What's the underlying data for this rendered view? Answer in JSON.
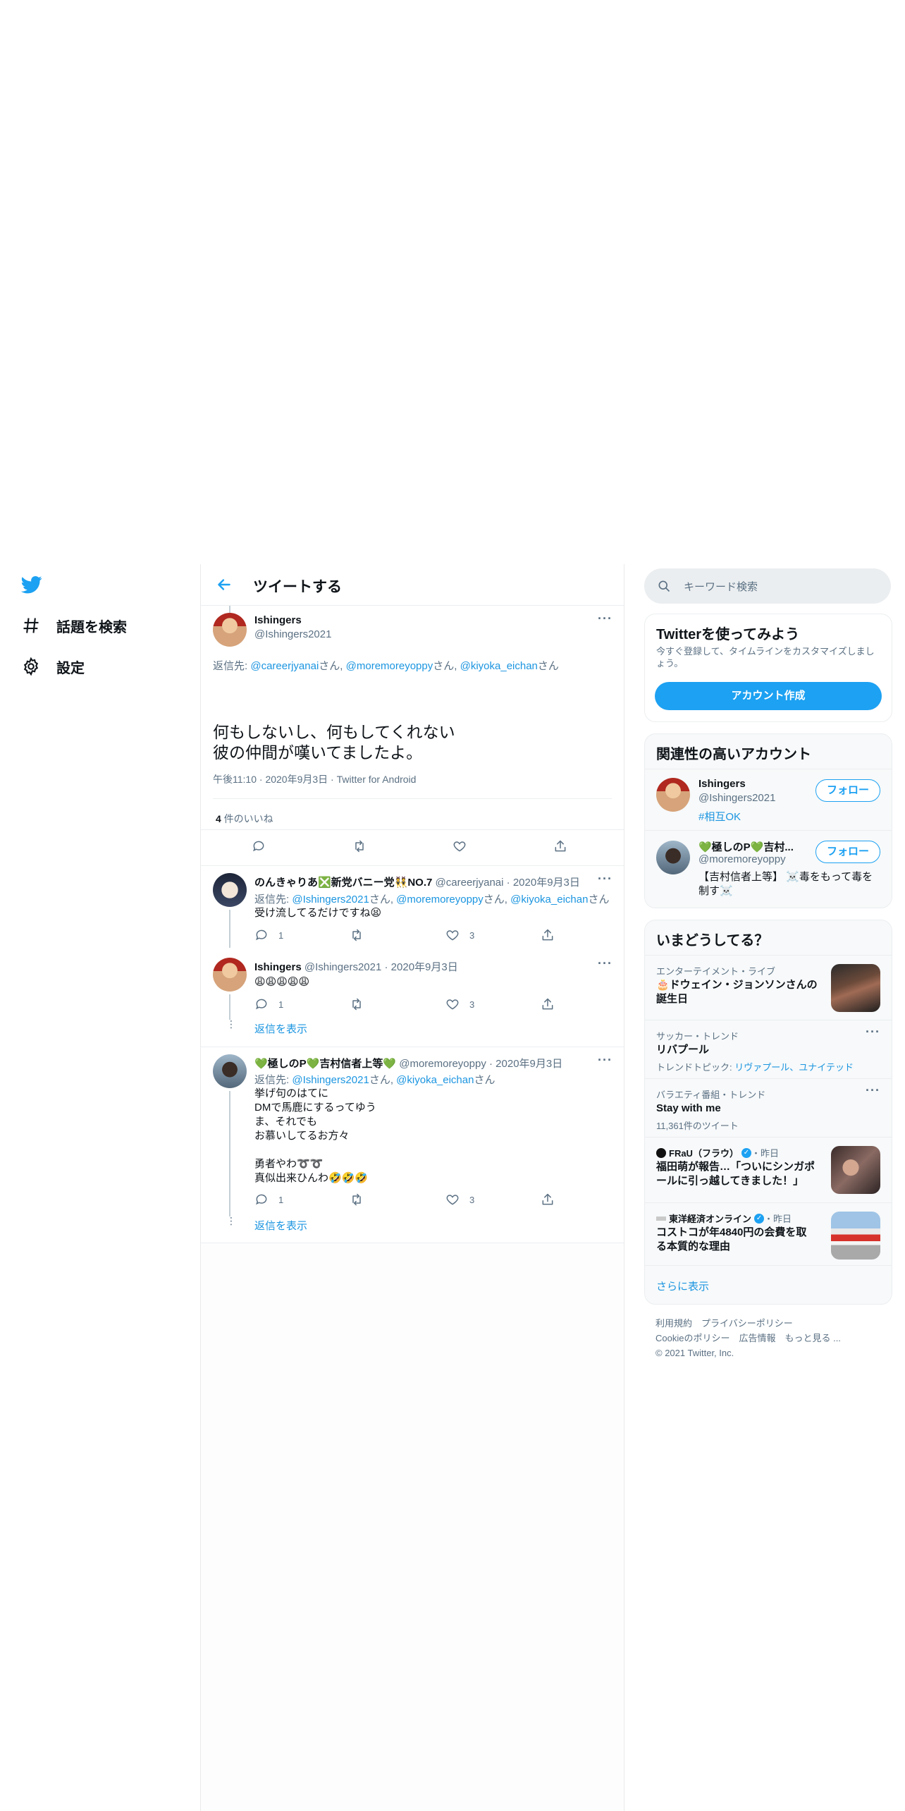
{
  "nav": {
    "items": [
      {
        "label": "話題を検索",
        "icon": "hashtag-icon"
      },
      {
        "label": "設定",
        "icon": "gear-icon"
      }
    ]
  },
  "header": {
    "title": "ツイートする"
  },
  "main_tweet": {
    "name": "Ishingers",
    "handle": "@Ishingers2021",
    "reply_prefix": "返信先: ",
    "reply_to": [
      "@careerjyanai",
      "@moremoreyoppy",
      "@kiyoka_eichan"
    ],
    "reply_suffix": "さん",
    "text_line1": "何もしないし、何もしてくれない",
    "text_line2": "彼の仲間が嘆いてましたよ。",
    "time": "午後11:10",
    "date": "2020年9月3日",
    "source": "Twitter for Android",
    "likes_count": "4",
    "likes_label": " 件のいいね"
  },
  "replies": [
    {
      "name": "のんきゃりあ❎新党バニー党👯NO.7",
      "handle": "@careerjyanai",
      "date": "2020年9月3日",
      "reply_to": [
        "@Ishingers2021",
        "@moremoreyoppy",
        "@kiyoka_eichan"
      ],
      "text": "受け流してるだけですね😫",
      "replies": "1",
      "likes": "3"
    },
    {
      "name": "Ishingers",
      "handle": "@Ishingers2021",
      "date": "2020年9月3日",
      "text": "😩😩😩😩😩",
      "replies": "1",
      "likes": "3",
      "show_more": "返信を表示"
    },
    {
      "name": "💚極しのP💚吉村信者上等💚",
      "handle": "@moremoreyoppy",
      "date": "2020年9月3日",
      "reply_to": [
        "@Ishingers2021",
        "@kiyoka_eichan"
      ],
      "lines": [
        "挙げ句のはてに",
        "DMで馬鹿にするってゆう",
        "ま、それでも",
        "お慕いしてるお方々",
        "",
        "勇者やわ➰➰",
        "真似出来ひんわ🤣🤣🤣"
      ],
      "replies": "1",
      "likes": "3",
      "show_more": "返信を表示"
    }
  ],
  "search": {
    "placeholder": "キーワード検索"
  },
  "signup": {
    "title": "Twitterを使ってみよう",
    "desc": "今すぐ登録して、タイムラインをカスタマイズしましょう。",
    "button": "アカウント作成"
  },
  "related": {
    "title": "関連性の高いアカウント",
    "accounts": [
      {
        "name": "Ishingers",
        "handle": "@Ishingers2021",
        "bio": "#相互OK",
        "follow": "フォロー"
      },
      {
        "name": "💚極しのP💚吉村...",
        "handle": "@moremoreyoppy",
        "bio": "【吉村信者上等】 ☠️毒をもって毒を制す☠️",
        "follow": "フォロー"
      }
    ]
  },
  "trends": {
    "title": "いまどうしてる？",
    "items": [
      {
        "cat": "エンターテイメント・ライブ",
        "name": "🎂ドウェイン・ジョンソンさんの誕生日"
      },
      {
        "cat": "サッカー・トレンド",
        "name": "リバプール",
        "sub_prefix": "トレンドトピック: ",
        "sub_links": "リヴァプール、ユナイテッド"
      },
      {
        "cat": "バラエティ番組・トレンド",
        "name": "Stay with me",
        "sub": "11,361件のツイート"
      },
      {
        "source": "FRaU（フラウ）",
        "when": "・昨日",
        "name": "福田萌が報告…「ついにシンガポールに引っ越してきました！」"
      },
      {
        "source": "東洋経済オンライン",
        "when": "・昨日",
        "name": "コストコが年4840円の会費を取る本質的な理由"
      }
    ],
    "more": "さらに表示"
  },
  "footer": {
    "line1": "利用規約　プライバシーポリシー",
    "line2": "Cookieのポリシー　広告情報　もっと見る ...",
    "line3": "© 2021 Twitter, Inc."
  },
  "colors": {
    "accent": "#1da1f2",
    "link": "#1b95e0",
    "muted": "#5b7083"
  }
}
